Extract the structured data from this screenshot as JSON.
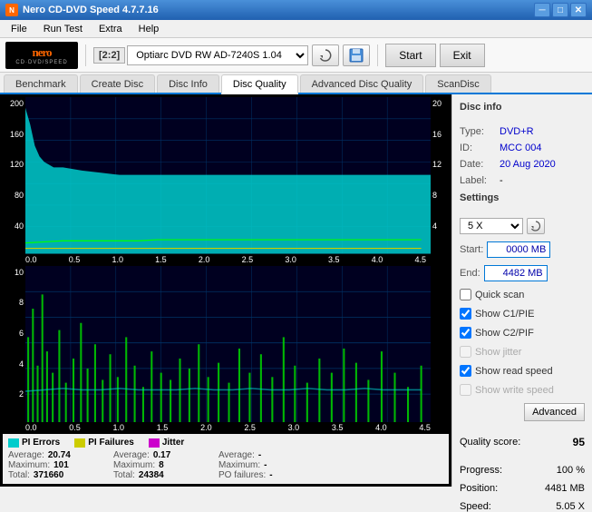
{
  "window": {
    "title": "Nero CD-DVD Speed 4.7.7.16",
    "title_icon": "N",
    "min_btn": "─",
    "max_btn": "□",
    "close_btn": "✕"
  },
  "menu": {
    "items": [
      "File",
      "Run Test",
      "Extra",
      "Help"
    ]
  },
  "toolbar": {
    "drive_label": "[2:2]",
    "drive_name": "Optiarc DVD RW AD-7240S 1.04",
    "start_btn": "Start",
    "exit_btn": "Exit"
  },
  "tabs": [
    {
      "label": "Benchmark"
    },
    {
      "label": "Create Disc"
    },
    {
      "label": "Disc Info"
    },
    {
      "label": "Disc Quality",
      "active": true
    },
    {
      "label": "Advanced Disc Quality"
    },
    {
      "label": "ScanDisc"
    }
  ],
  "disc_info": {
    "section": "Disc info",
    "type_label": "Type:",
    "type_val": "DVD+R",
    "id_label": "ID:",
    "id_val": "MCC 004",
    "date_label": "Date:",
    "date_val": "20 Aug 2020",
    "label_label": "Label:",
    "label_val": "-"
  },
  "settings": {
    "section": "Settings",
    "speed_val": "5 X",
    "start_label": "Start:",
    "start_val": "0000 MB",
    "end_label": "End:",
    "end_val": "4482 MB",
    "quick_scan": "Quick scan",
    "show_c1pie": "Show C1/PIE",
    "show_c2pif": "Show C2/PIF",
    "show_jitter": "Show jitter",
    "show_read": "Show read speed",
    "show_write": "Show write speed",
    "advanced_btn": "Advanced"
  },
  "quality": {
    "score_label": "Quality score:",
    "score_val": "95",
    "progress_label": "Progress:",
    "progress_val": "100 %",
    "position_label": "Position:",
    "position_val": "4481 MB",
    "speed_label": "Speed:",
    "speed_val": "5.05 X"
  },
  "legend": {
    "pi_errors_color": "#00ffff",
    "pi_failures_color": "#ffff00",
    "jitter_color": "#ff00ff",
    "pi_errors_label": "PI Errors",
    "pi_failures_label": "PI Failures",
    "jitter_label": "Jitter"
  },
  "stats": {
    "pi_errors": {
      "avg_label": "Average:",
      "avg_val": "20.74",
      "max_label": "Maximum:",
      "max_val": "101",
      "total_label": "Total:",
      "total_val": "371660"
    },
    "pi_failures": {
      "avg_label": "Average:",
      "avg_val": "0.17",
      "max_label": "Maximum:",
      "max_val": "8",
      "total_label": "Total:",
      "total_val": "24384"
    },
    "jitter": {
      "avg_label": "Average:",
      "avg_val": "-",
      "max_label": "Maximum:",
      "max_val": "-",
      "po_label": "PO failures:",
      "po_val": "-"
    }
  },
  "chart1": {
    "y_labels_left": [
      "200",
      "160",
      "120",
      "80",
      "40"
    ],
    "y_labels_right": [
      "20",
      "16",
      "12",
      "8",
      "4"
    ],
    "x_labels": [
      "0.0",
      "0.5",
      "1.0",
      "1.5",
      "2.0",
      "2.5",
      "3.0",
      "3.5",
      "4.0",
      "4.5"
    ]
  },
  "chart2": {
    "y_labels_left": [
      "10",
      "8",
      "6",
      "4",
      "2"
    ],
    "x_labels": [
      "0.0",
      "0.5",
      "1.0",
      "1.5",
      "2.0",
      "2.5",
      "3.0",
      "3.5",
      "4.0",
      "4.5"
    ]
  }
}
